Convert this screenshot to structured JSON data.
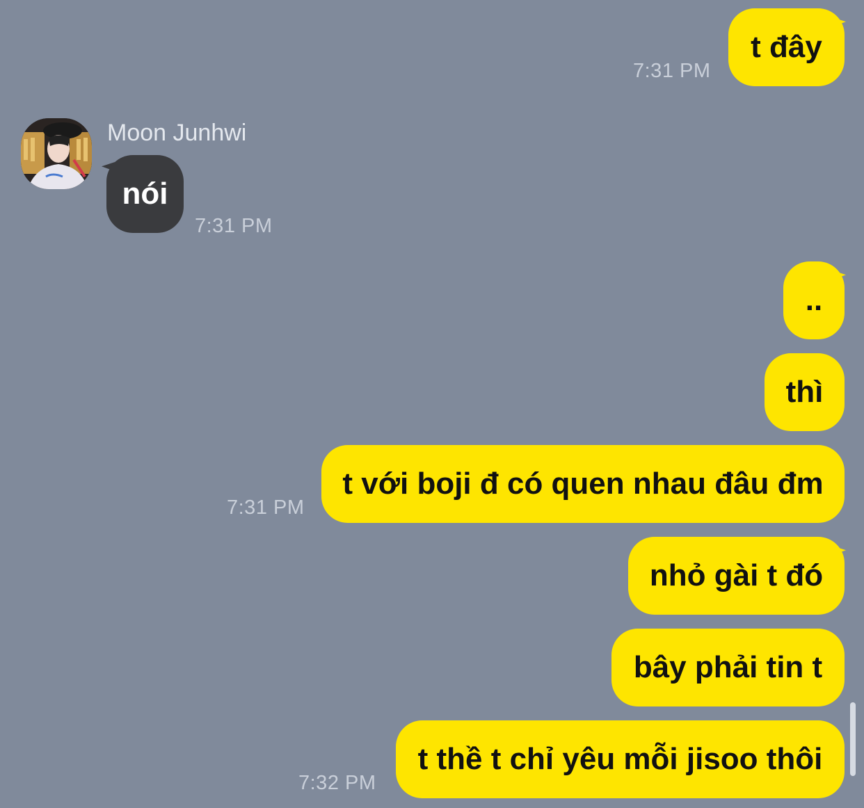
{
  "contact": {
    "name": "Moon Junhwi"
  },
  "messages": [
    {
      "from": "me",
      "text": "t đây",
      "time": "7:31 PM"
    },
    {
      "from": "them",
      "text": "nói",
      "time": "7:31 PM"
    },
    {
      "from": "me",
      "text": "..",
      "time": ""
    },
    {
      "from": "me",
      "text": "thì",
      "time": ""
    },
    {
      "from": "me",
      "text": "t với boji đ có quen nhau đâu đm",
      "time": "7:31 PM"
    },
    {
      "from": "me",
      "text": "nhỏ gài t đó",
      "time": ""
    },
    {
      "from": "me",
      "text": "bây phải tin t",
      "time": ""
    },
    {
      "from": "me",
      "text": "t thề t chỉ yêu mỗi jisoo thôi",
      "time": "7:32 PM"
    }
  ],
  "colors": {
    "background": "#808a9b",
    "my_bubble": "#fee500",
    "their_bubble": "#3a3b3e",
    "timestamp": "#c9cfd9"
  }
}
